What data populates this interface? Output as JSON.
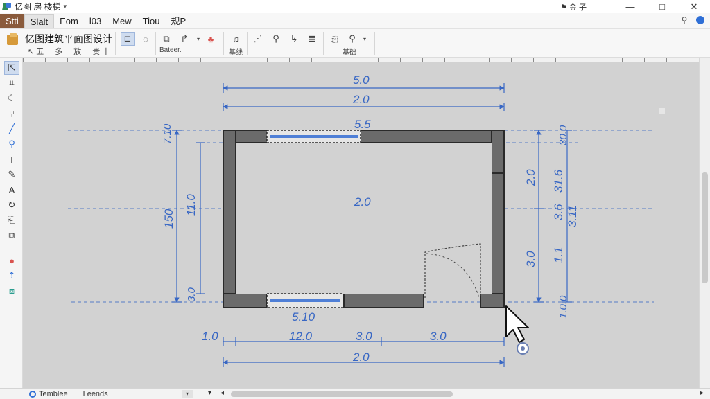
{
  "window": {
    "title": "亿图 房 楼梯",
    "account": "⚑ 金 子",
    "controls": {
      "minimize": "—",
      "maximize": "□",
      "close": "✕"
    }
  },
  "menubar": {
    "items": [
      "Stti",
      "Slalt",
      "Eom",
      "l03",
      "Mew",
      "Tiou",
      "规P"
    ],
    "right_icons": [
      "share-icon",
      "help-icon"
    ]
  },
  "ribbon": {
    "document_title": "亿图建筑平面图设计",
    "sub_actions": [
      "↖",
      "↗",
      "←",
      "↑"
    ],
    "sub_action_labels": [
      "↖ 五",
      "多",
      "放",
      "贵 十"
    ],
    "group_captions": [
      "Bateer.",
      "基线",
      "基础"
    ]
  },
  "toolbox": {
    "tools": [
      "select",
      "crop",
      "lasso",
      "connector",
      "line",
      "zoom",
      "text",
      "pen",
      "fill",
      "rotate",
      "clip",
      "duplicate",
      "color",
      "arrow",
      "layer"
    ]
  },
  "plan": {
    "dimensions": {
      "top_overall": "5.0",
      "top_inner": "2.0",
      "window_top": "5.5",
      "center": "2.0",
      "window_bottom": "5.10",
      "bottom_segment_1": "1.0",
      "bottom_segment_2": "12.0",
      "bottom_segment_3": "3.0",
      "bottom_segment_4": "3.0",
      "bottom_overall": "2.0",
      "left_top": "7.10",
      "left_overall": "150",
      "left_inner": "11.0",
      "left_bottom": "3.0",
      "right_top": "30.0",
      "right_seg_1": "2.0",
      "right_seg_2": "3.6",
      "right_seg_3": "31.6",
      "right_seg_4": "3.0",
      "right_seg_5": "1.1",
      "right_overall": "3.11",
      "right_bottom": "1.0.0"
    },
    "colors": {
      "dimension": "#3867c4",
      "wall": "#6b6b6b",
      "wall_outline": "#2a2a2a",
      "canvas": "#d2d2d2",
      "window": "#4f7fd6"
    }
  },
  "statusbar": {
    "tab_template": "Temblee",
    "tab_legends": "Leends",
    "layer_caret": "▾",
    "zoom_caret": "▾",
    "scroll_left": "◂",
    "scroll_right": "▸"
  }
}
